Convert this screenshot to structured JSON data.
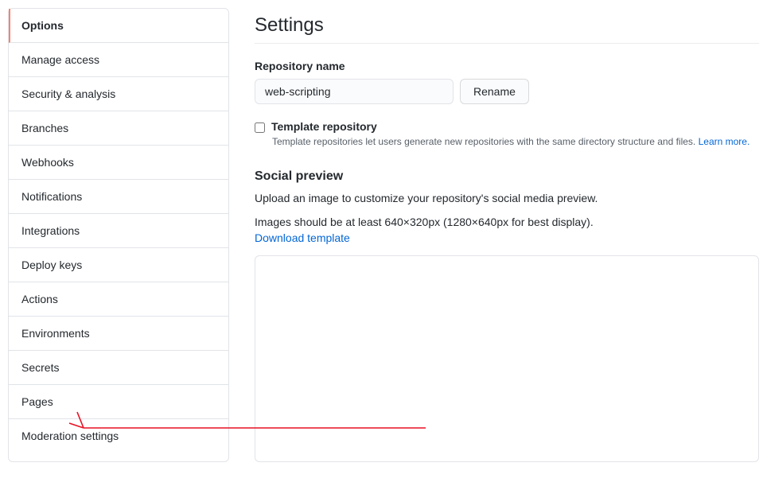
{
  "sidebar": {
    "items": [
      {
        "label": "Options",
        "active": true
      },
      {
        "label": "Manage access",
        "active": false
      },
      {
        "label": "Security & analysis",
        "active": false
      },
      {
        "label": "Branches",
        "active": false
      },
      {
        "label": "Webhooks",
        "active": false
      },
      {
        "label": "Notifications",
        "active": false
      },
      {
        "label": "Integrations",
        "active": false
      },
      {
        "label": "Deploy keys",
        "active": false
      },
      {
        "label": "Actions",
        "active": false
      },
      {
        "label": "Environments",
        "active": false
      },
      {
        "label": "Secrets",
        "active": false
      },
      {
        "label": "Pages",
        "active": false
      },
      {
        "label": "Moderation settings",
        "active": false
      }
    ]
  },
  "main": {
    "title": "Settings",
    "repo_name": {
      "label": "Repository name",
      "value": "web-scripting",
      "rename_button": "Rename"
    },
    "template": {
      "label": "Template repository",
      "help_prefix": "Template repositories let users generate new repositories with the same directory structure and files. ",
      "learn_more": "Learn more."
    },
    "social": {
      "heading": "Social preview",
      "line1": "Upload an image to customize your repository's social media preview.",
      "line2": "Images should be at least 640×320px (1280×640px for best display).",
      "download": "Download template"
    }
  }
}
